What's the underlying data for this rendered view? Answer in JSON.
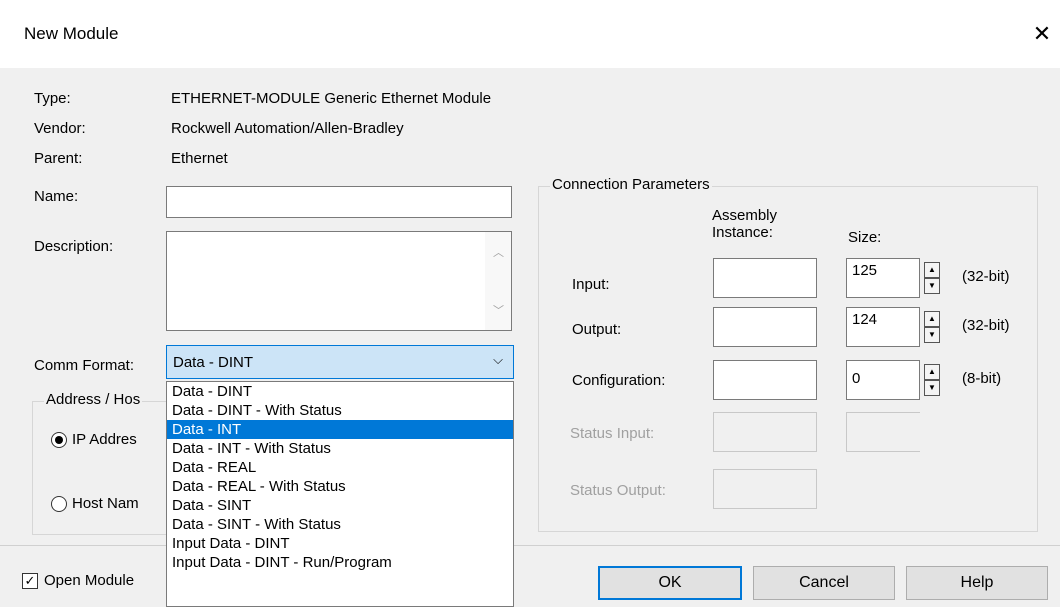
{
  "window": {
    "title": "New Module",
    "close_glyph": "✕"
  },
  "info": {
    "type_label": "Type:",
    "type_value": "ETHERNET-MODULE Generic Ethernet Module",
    "vendor_label": "Vendor:",
    "vendor_value": "Rockwell Automation/Allen-Bradley",
    "parent_label": "Parent:",
    "parent_value": "Ethernet"
  },
  "name": {
    "label": "Name:",
    "value": ""
  },
  "description": {
    "label": "Description:",
    "value": ""
  },
  "comm_format": {
    "label": "Comm Format:",
    "selected": "Data - DINT",
    "options": [
      "Data - DINT",
      "Data - DINT - With Status",
      "Data - INT",
      "Data - INT - With Status",
      "Data - REAL",
      "Data - REAL - With Status",
      "Data - SINT",
      "Data - SINT - With Status",
      "Input Data - DINT",
      "Input Data - DINT - Run/Program"
    ],
    "highlighted_index": 2
  },
  "address": {
    "legend": "Address / Hos",
    "ip_label": "IP Addres",
    "host_label": "Host Nam",
    "ip_selected": true
  },
  "connection": {
    "legend": "Connection Parameters",
    "assembly_header_line1": "Assembly",
    "assembly_header_line2": "Instance:",
    "size_header": "Size:",
    "rows": [
      {
        "label": "Input:",
        "instance": "",
        "size": "125",
        "unit": "(32-bit)"
      },
      {
        "label": "Output:",
        "instance": "",
        "size": "124",
        "unit": "(32-bit)"
      },
      {
        "label": "Configuration:",
        "instance": "",
        "size": "0",
        "unit": "(8-bit)"
      }
    ],
    "status_input_label": "Status Input:",
    "status_output_label": "Status Output:"
  },
  "footer": {
    "open_module_label": "Open Module",
    "open_module_checked": true,
    "ok": "OK",
    "cancel": "Cancel",
    "help": "Help"
  },
  "colors": {
    "accent": "#0078d7",
    "selection_bg": "#cce4f7"
  }
}
